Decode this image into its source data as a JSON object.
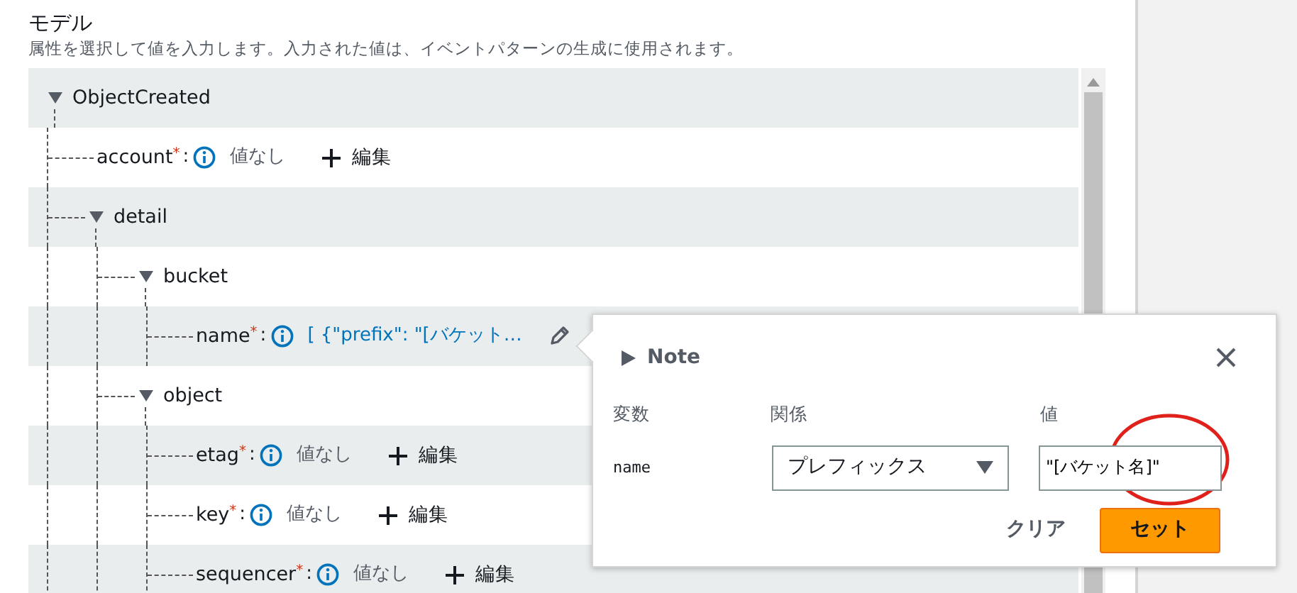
{
  "section": {
    "title": "モデル",
    "description": "属性を選択して値を入力します。入力された値は、イベントパターンの生成に使用されます。"
  },
  "required_mark": "*",
  "separator": ":",
  "tree": [
    {
      "label": "ObjectCreated",
      "expanded": true,
      "children": [
        {
          "label": "account",
          "required": true,
          "kind": "empty",
          "value": "値なし",
          "action": "編集"
        },
        {
          "label": "detail",
          "expanded": true,
          "children": [
            {
              "label": "bucket",
              "expanded": true,
              "children": [
                {
                  "label": "name",
                  "required": true,
                  "kind": "set",
                  "value": "[ {\"prefix\": \"[バケット…"
                }
              ]
            },
            {
              "label": "object",
              "expanded": true,
              "children": [
                {
                  "label": "etag",
                  "required": true,
                  "kind": "empty",
                  "value": "値なし",
                  "action": "編集"
                },
                {
                  "label": "key",
                  "required": true,
                  "kind": "empty",
                  "value": "値なし",
                  "action": "編集"
                },
                {
                  "label": "sequencer",
                  "required": true,
                  "kind": "empty",
                  "value": "値なし",
                  "action": "編集"
                }
              ]
            }
          ]
        }
      ]
    }
  ],
  "popover": {
    "title": "Note",
    "expanded": false,
    "columns": [
      "変数",
      "関係",
      "値"
    ],
    "variable": "name",
    "relation": "プレフィックス",
    "value": "\"[バケット名]\"",
    "buttons": [
      {
        "label": "クリア",
        "kind": "link"
      },
      {
        "label": "セット",
        "kind": "primary"
      }
    ]
  }
}
